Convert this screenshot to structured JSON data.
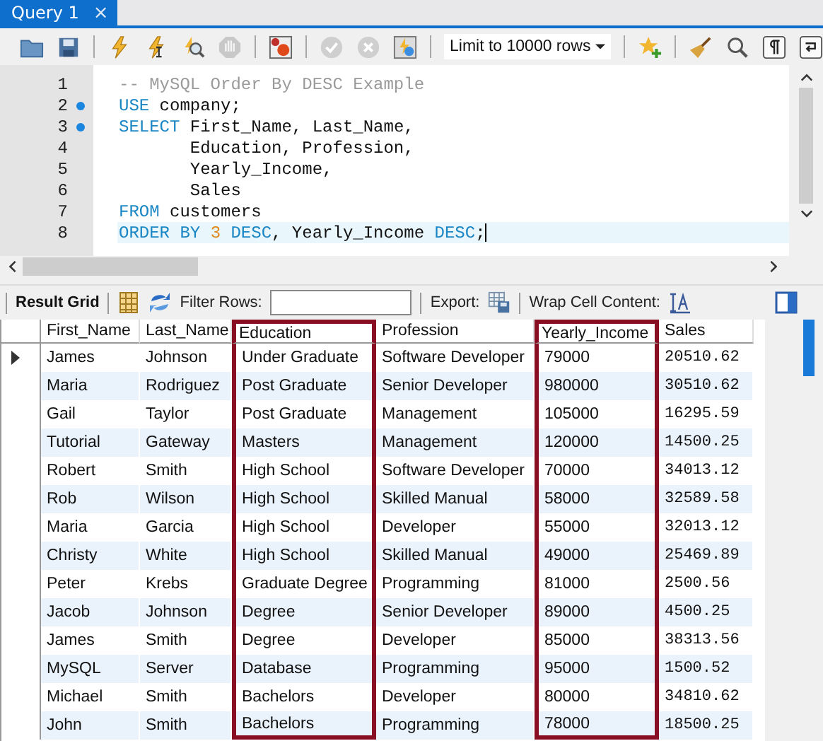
{
  "tab": {
    "title": "Query 1",
    "close": "×"
  },
  "limit": {
    "value": "Limit to 10000 rows"
  },
  "editor": {
    "lines": [
      {
        "number": "1",
        "bookmark": false,
        "current": false,
        "tokens": [
          {
            "text": "-- MySQL Order By DESC Example",
            "kind": "comment"
          }
        ]
      },
      {
        "number": "2",
        "bookmark": true,
        "current": false,
        "tokens": [
          {
            "text": "USE",
            "kind": "keyword"
          },
          {
            "text": " company;",
            "kind": "plain"
          }
        ]
      },
      {
        "number": "3",
        "bookmark": true,
        "current": false,
        "tokens": [
          {
            "text": "SELECT",
            "kind": "keyword"
          },
          {
            "text": " First_Name, Last_Name,",
            "kind": "plain"
          }
        ]
      },
      {
        "number": "4",
        "bookmark": false,
        "current": false,
        "tokens": [
          {
            "text": "       Education, Profession,",
            "kind": "plain"
          }
        ]
      },
      {
        "number": "5",
        "bookmark": false,
        "current": false,
        "tokens": [
          {
            "text": "       Yearly_Income,",
            "kind": "plain"
          }
        ]
      },
      {
        "number": "6",
        "bookmark": false,
        "current": false,
        "tokens": [
          {
            "text": "       Sales",
            "kind": "plain"
          }
        ]
      },
      {
        "number": "7",
        "bookmark": false,
        "current": false,
        "tokens": [
          {
            "text": "FROM",
            "kind": "keyword"
          },
          {
            "text": " customers",
            "kind": "plain"
          }
        ]
      },
      {
        "number": "8",
        "bookmark": false,
        "current": true,
        "tokens": [
          {
            "text": "ORDER BY ",
            "kind": "keyword"
          },
          {
            "text": "3",
            "kind": "number"
          },
          {
            "text": " DESC",
            "kind": "keyword"
          },
          {
            "text": ", Yearly_Income ",
            "kind": "plain"
          },
          {
            "text": "DESC",
            "kind": "keyword"
          },
          {
            "text": ";",
            "kind": "plain"
          }
        ]
      }
    ]
  },
  "result_toolbar": {
    "title": "Result Grid",
    "filter_label": "Filter Rows:",
    "export_label": "Export:",
    "wrap_label": "Wrap Cell Content:"
  },
  "table": {
    "columns": [
      {
        "label": "First_Name",
        "highlighted": false
      },
      {
        "label": "Last_Name",
        "highlighted": false
      },
      {
        "label": "Education",
        "highlighted": true
      },
      {
        "label": "Profession",
        "highlighted": false
      },
      {
        "label": "Yearly_Income",
        "highlighted": true
      },
      {
        "label": "Sales",
        "highlighted": false
      }
    ],
    "rows": [
      {
        "current": true,
        "cells": [
          "James",
          "Johnson",
          "Under Graduate",
          "Software Developer",
          "79000",
          "20510.62"
        ]
      },
      {
        "current": false,
        "cells": [
          "Maria",
          "Rodriguez",
          "Post Graduate",
          "Senior Developer",
          "980000",
          "30510.62"
        ]
      },
      {
        "current": false,
        "cells": [
          "Gail",
          "Taylor",
          "Post Graduate",
          "Management",
          "105000",
          "16295.59"
        ]
      },
      {
        "current": false,
        "cells": [
          "Tutorial",
          "Gateway",
          "Masters",
          "Management",
          "120000",
          "14500.25"
        ]
      },
      {
        "current": false,
        "cells": [
          "Robert",
          "Smith",
          "High School",
          "Software Developer",
          "70000",
          "34013.12"
        ]
      },
      {
        "current": false,
        "cells": [
          "Rob",
          "Wilson",
          "High School",
          "Skilled Manual",
          "58000",
          "32589.58"
        ]
      },
      {
        "current": false,
        "cells": [
          "Maria",
          "Garcia",
          "High School",
          "Developer",
          "55000",
          "32013.12"
        ]
      },
      {
        "current": false,
        "cells": [
          "Christy",
          "White",
          "High School",
          "Skilled Manual",
          "49000",
          "25469.89"
        ]
      },
      {
        "current": false,
        "cells": [
          "Peter",
          "Krebs",
          "Graduate Degree",
          "Programming",
          "81000",
          "2500.56"
        ]
      },
      {
        "current": false,
        "cells": [
          "Jacob",
          "Johnson",
          "Degree",
          "Senior Developer",
          "89000",
          "4500.25"
        ]
      },
      {
        "current": false,
        "cells": [
          "James",
          "Smith",
          "Degree",
          "Developer",
          "85000",
          "38313.56"
        ]
      },
      {
        "current": false,
        "cells": [
          "MySQL",
          "Server",
          "Database",
          "Programming",
          "95000",
          "1500.52"
        ]
      },
      {
        "current": false,
        "cells": [
          "Michael",
          "Smith",
          "Bachelors",
          "Developer",
          "80000",
          "34810.62"
        ]
      },
      {
        "current": false,
        "cells": [
          "John",
          "Smith",
          "Bachelors",
          "Programming",
          "78000",
          "18500.25"
        ]
      }
    ]
  }
}
